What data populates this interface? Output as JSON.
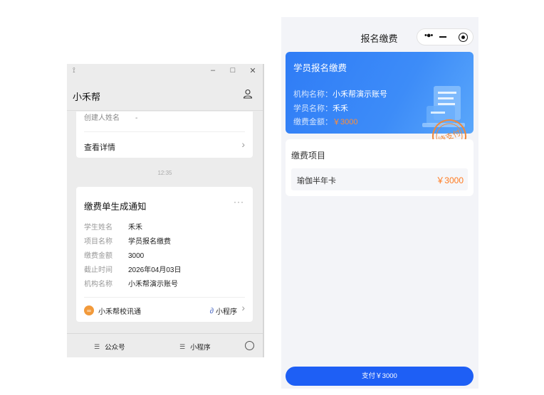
{
  "chat_window": {
    "title": "小禾帮",
    "controls": {
      "minimize": "–",
      "maximize": "□",
      "close": "✕"
    },
    "card_prev": {
      "creator_label": "创建人姓名",
      "creator_value": "-",
      "detail_link": "查看详情"
    },
    "timestamp": "12:35",
    "notice": {
      "title": "缴费单生成通知",
      "more": "···",
      "rows": [
        {
          "label": "学生姓名",
          "value": "禾禾"
        },
        {
          "label": "项目名称",
          "value": "学员报名缴费"
        },
        {
          "label": "缴费金额",
          "value": "3000"
        },
        {
          "label": "截止时间",
          "value": "2026年04月03日"
        },
        {
          "label": "机构名称",
          "value": "小禾帮演示账号"
        }
      ],
      "source": "小禾帮校讯通",
      "source_logo": "∞",
      "mini_program": "小程序"
    },
    "bottom_bar": {
      "official_account": "公众号",
      "mini_program": "小程序"
    }
  },
  "phone": {
    "nav_title": "报名缴费",
    "banner": {
      "title": "学员报名缴费",
      "org_label": "机构名称：",
      "org_value": "小禾帮演示账号",
      "student_label": "学员名称：",
      "student_value": "禾禾",
      "amount_label": "缴费金额：",
      "amount_value": "￥3000"
    },
    "stamp_text": "待支付",
    "items_card": {
      "title": "缴费项目",
      "items": [
        {
          "name": "瑜伽半年卡",
          "price": "￥3000"
        }
      ]
    },
    "pay_button": "支付￥3000"
  },
  "colors": {
    "primary_blue": "#1e5ff5",
    "amount_orange": "#ff7a1f",
    "stamp_orange": "#f0883a"
  }
}
